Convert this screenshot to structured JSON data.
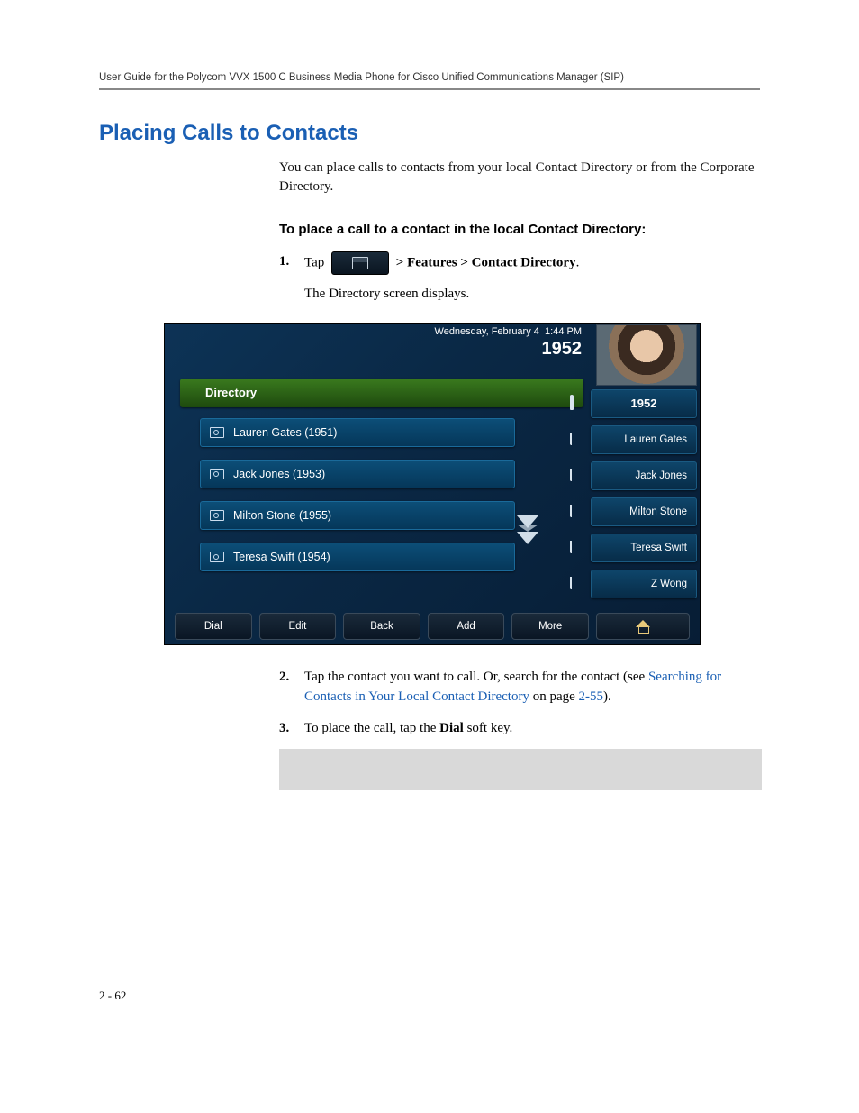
{
  "header": "User Guide for the Polycom VVX 1500 C Business Media Phone for Cisco Unified Communications Manager (SIP)",
  "section_title": "Placing Calls to Contacts",
  "intro": "You can place calls to contacts from your local Contact Directory or from the Corporate Directory.",
  "subhead": "To place a call to a contact in the local Contact Directory:",
  "step1_prefix": "Tap",
  "step1_suffix_label": " > Features > Contact Directory",
  "step1_suffix_end": ".",
  "step1_sub": "The Directory screen displays.",
  "step2_a": "Tap the contact you want to call. Or, search for the contact (see ",
  "step2_link": "Searching for Contacts in Your Local Contact Directory",
  "step2_b": " on page ",
  "step2_pageref": "2-55",
  "step2_c": ").",
  "step3_a": "To place the call, tap the ",
  "step3_bold": "Dial",
  "step3_b": " soft key.",
  "page_number": "2 - 62",
  "screenshot": {
    "date": "Wednesday, February 4",
    "time": "1:44 PM",
    "extension": "1952",
    "directory_label": "Directory",
    "contacts": [
      "Lauren Gates (1951)",
      "Jack Jones (1953)",
      "Milton Stone (1955)",
      "Teresa Swift (1954)"
    ],
    "sidebar": {
      "ext": "1952",
      "items": [
        "Lauren Gates",
        "Jack Jones",
        "Milton Stone",
        "Teresa Swift",
        "Z Wong"
      ]
    },
    "softkeys": [
      "Dial",
      "Edit",
      "Back",
      "Add",
      "More"
    ]
  }
}
